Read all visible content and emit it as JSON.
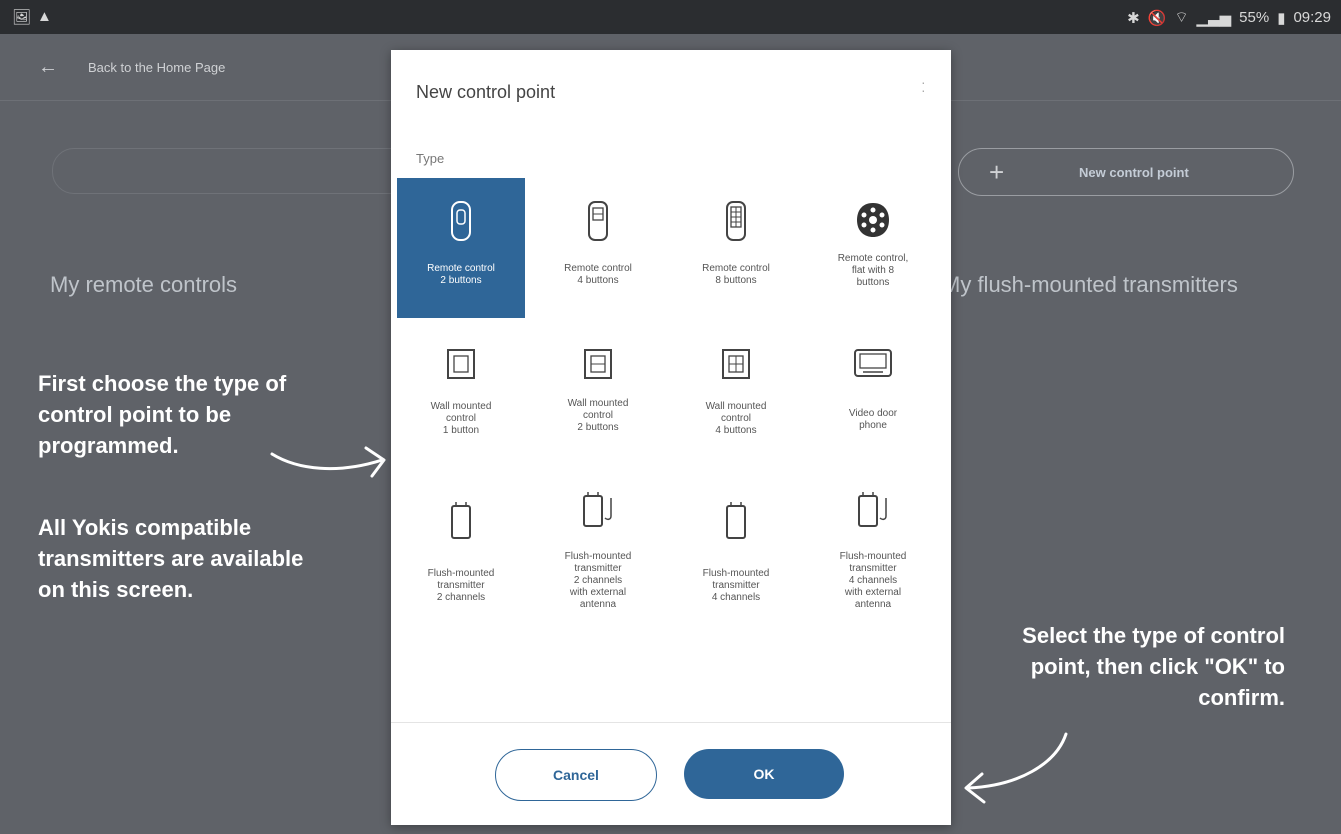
{
  "status_bar": {
    "battery": "55%",
    "time": "09:29"
  },
  "app_bar": {
    "back_label": "Back to the Home Page"
  },
  "background": {
    "new_control_point_button": "New control point",
    "section_left": "My remote controls",
    "section_right": "My flush-mounted transmitters"
  },
  "dialog": {
    "title": "New control point",
    "type_label": "Type",
    "tiles": [
      {
        "caption": "Remote control\n2 buttons",
        "icon": "remote-2-icon",
        "selected": true
      },
      {
        "caption": "Remote control\n4 buttons",
        "icon": "remote-4-icon"
      },
      {
        "caption": "Remote control\n8 buttons",
        "icon": "remote-8-icon"
      },
      {
        "caption": "Remote control,\nflat with 8\nbuttons",
        "icon": "remote-flat-icon"
      },
      {
        "caption": "Wall mounted\ncontrol\n1 button",
        "icon": "wall-1-icon"
      },
      {
        "caption": "Wall mounted\ncontrol\n2 buttons",
        "icon": "wall-2-icon"
      },
      {
        "caption": "Wall mounted\ncontrol\n4 buttons",
        "icon": "wall-4-icon"
      },
      {
        "caption": "Video door\nphone",
        "icon": "video-phone-icon"
      },
      {
        "caption": "Flush-mounted\ntransmitter\n2 channels",
        "icon": "flush-2-icon"
      },
      {
        "caption": "Flush-mounted\ntransmitter\n2 channels\nwith external\nantenna",
        "icon": "flush-2-antenna-icon"
      },
      {
        "caption": "Flush-mounted\ntransmitter\n4 channels",
        "icon": "flush-4-icon"
      },
      {
        "caption": "Flush-mounted\ntransmitter\n4 channels\nwith external\nantenna",
        "icon": "flush-4-antenna-icon"
      }
    ],
    "cancel_label": "Cancel",
    "ok_label": "OK"
  },
  "annotations": {
    "first": "First choose the type of control point to be programmed.",
    "second": "All Yokis compatible transmitters are available on this screen.",
    "third": "Select the type of control point, then click \"OK\" to confirm."
  },
  "colors": {
    "accent": "#2f6698",
    "overlay": "#5f6268"
  }
}
